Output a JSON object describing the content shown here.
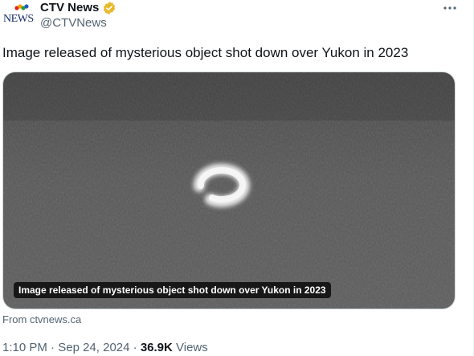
{
  "author": {
    "logo_text": "NEWS",
    "display_name": "CTV News",
    "handle": "@CTVNews",
    "verified": true
  },
  "tweet": {
    "text": "Image released of mysterious object shot down over Yukon in 2023"
  },
  "media": {
    "caption": "Image released of mysterious object shot down over Yukon in 2023",
    "source": "From ctvnews.ca"
  },
  "meta": {
    "time": "1:10 PM",
    "date": "Sep 24, 2024",
    "separator": " · ",
    "views_count": "36.9K",
    "views_label": " Views"
  },
  "icons": {
    "more": "more-options-icon",
    "verified": "verified-badge-icon",
    "logo": "ctv-logo-icon"
  },
  "colors": {
    "verified_gold": "#e8b829",
    "secondary_text": "#536471",
    "primary_text": "#0f1419"
  }
}
